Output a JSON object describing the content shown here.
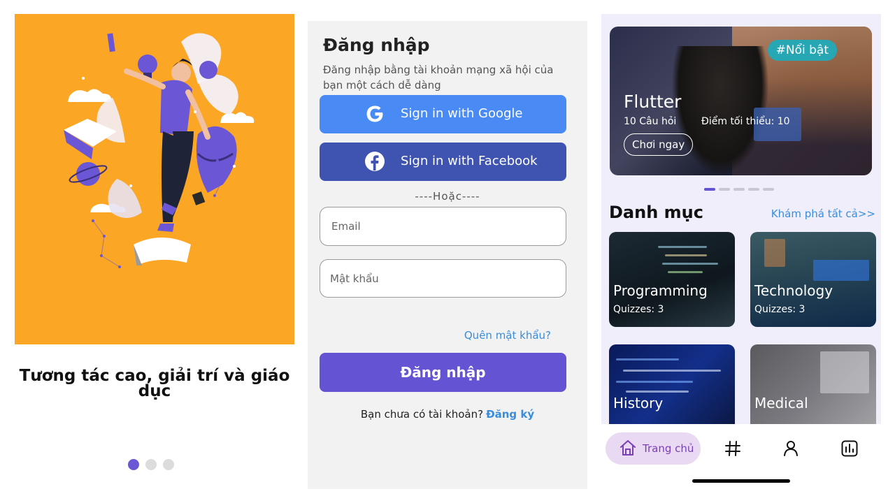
{
  "onboarding": {
    "title": "Tương tác cao, giải trí và giáo dục",
    "dots": 3,
    "active_dot": 0,
    "accent": "#FBA625",
    "dot_active_color": "#6B57D6"
  },
  "login": {
    "title": "Đăng nhập",
    "subtitle": "Đăng nhập bằng tài khoản mạng xã hội của bạn một cách dễ dàng",
    "google_label": "Sign in with Google",
    "facebook_label": "Sign in with Facebook",
    "or_text": "----Hoặc----",
    "email_placeholder": "Email",
    "password_placeholder": "Mật khẩu",
    "forgot": "Quên mật khẩu?",
    "login_button": "Đăng nhập",
    "no_account": "Bạn chưa có tài khoản?",
    "signup": "Đăng ký",
    "colors": {
      "google": "#4A8AF4",
      "facebook": "#3F54B0",
      "primary": "#6453D2",
      "link": "#3A8DDB"
    }
  },
  "home": {
    "featured": {
      "badge": "#Nổi bật",
      "title": "Flutter",
      "questions": "10 Câu hỏi",
      "min_score": "Điểm tối thiểu: 10",
      "play": "Chơi ngay"
    },
    "carousel": {
      "count": 5,
      "active": 0
    },
    "section_title": "Danh mục",
    "see_all": "Khám phá tất cả>>",
    "categories": [
      {
        "name": "Programming",
        "quizzes": "Quizzes: 3"
      },
      {
        "name": "Technology",
        "quizzes": "Quizzes: 3"
      },
      {
        "name": "History"
      },
      {
        "name": "Medical"
      }
    ],
    "nav": {
      "home_label": "Trang chủ",
      "items": [
        "home-icon",
        "hashtag-icon",
        "profile-icon",
        "leaderboard-icon"
      ]
    }
  }
}
